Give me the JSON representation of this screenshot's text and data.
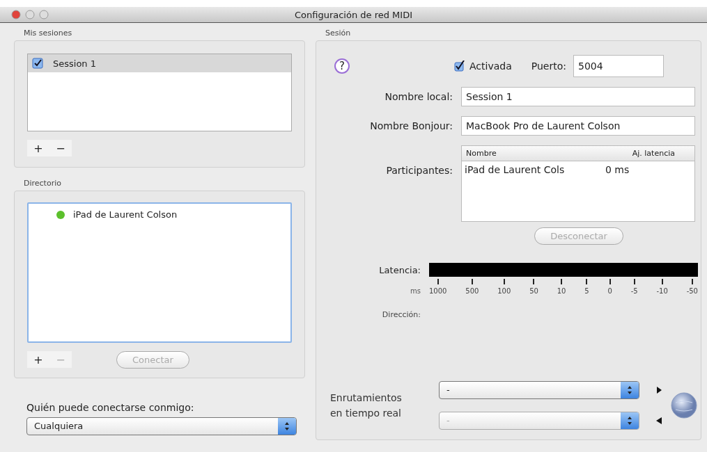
{
  "window": {
    "title": "Configuración de red MIDI"
  },
  "my_sessions": {
    "label": "Mis sesiones",
    "items": [
      {
        "name": "Session 1",
        "checked": true,
        "selected": true
      }
    ],
    "buttons": [
      {
        "label": "+",
        "disabled": false
      },
      {
        "label": "−",
        "disabled": false
      }
    ]
  },
  "directory": {
    "label": "Directorio",
    "items": [
      {
        "name": "iPad de Laurent Colson",
        "color": "#5cc02c"
      }
    ],
    "buttons": [
      {
        "label": "+",
        "disabled": false
      },
      {
        "label": "−",
        "disabled": true
      }
    ],
    "connect_button": {
      "label": "Conectar",
      "disabled": true
    }
  },
  "who_can_connect": {
    "label": "Quién puede conectarse conmigo:",
    "value": "Cualquiera"
  },
  "session": {
    "label": "Sesión",
    "help": "?",
    "enabled": {
      "label": "Activada",
      "checked": true
    },
    "port": {
      "label": "Puerto:",
      "value": "5004"
    },
    "local_name": {
      "label": "Nombre local:",
      "value": "Session 1"
    },
    "bonjour_name": {
      "label": "Nombre Bonjour:",
      "value": "MacBook Pro de Laurent Colson"
    },
    "participants": {
      "label": "Participantes:",
      "columns": [
        "Nombre",
        "Aj. latencia"
      ],
      "rows": [
        [
          "iPad de Laurent Cols",
          "0 ms"
        ]
      ]
    },
    "disconnect_button": {
      "label": "Desconectar",
      "disabled": true
    },
    "latency": {
      "label": "Latencia:",
      "unit": "ms",
      "scale": [
        "1000",
        "500",
        "100",
        "50",
        "10",
        "5",
        "0",
        "-5",
        "-10",
        "-50"
      ]
    },
    "direction": {
      "label": "Dirección:"
    },
    "routing": {
      "label": "Enrutamientos en tiempo real",
      "selects": [
        {
          "value": "-",
          "disabled": false
        },
        {
          "value": "-",
          "disabled": true
        }
      ]
    }
  }
}
